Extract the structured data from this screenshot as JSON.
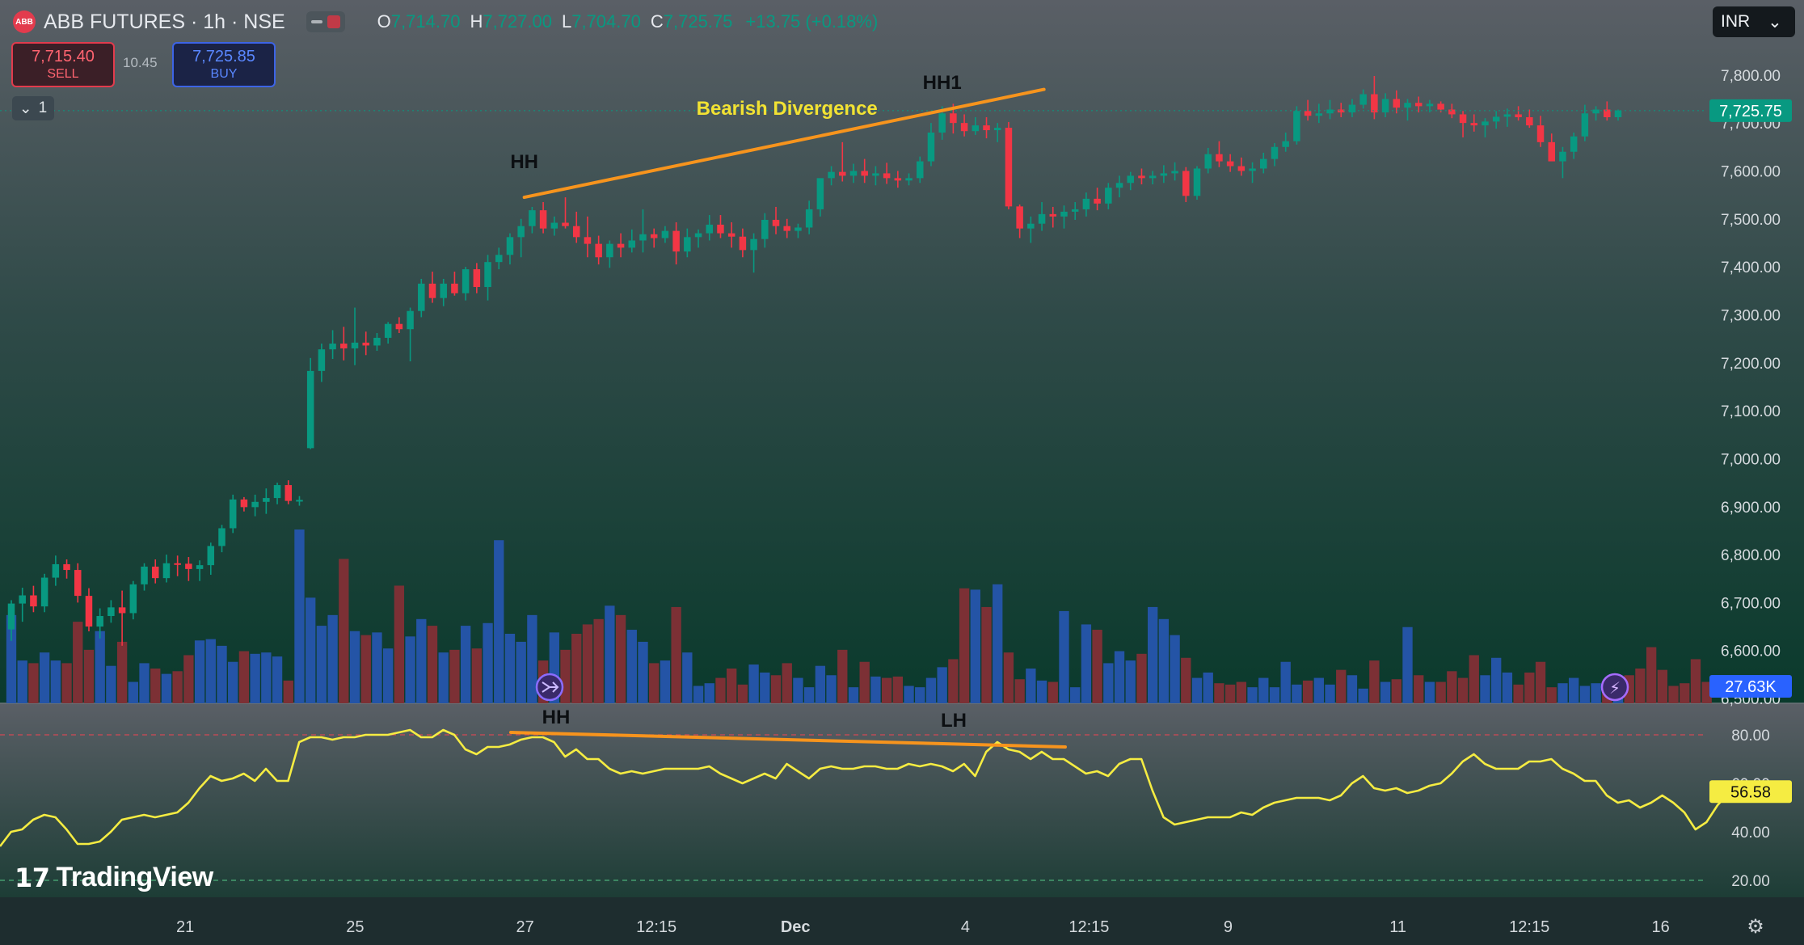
{
  "header": {
    "logo": "ABB",
    "symbol": "ABB FUTURES · 1h · NSE",
    "ohlc": [
      {
        "label": "O",
        "value": "7,714.70"
      },
      {
        "label": "H",
        "value": "7,727.00"
      },
      {
        "label": "L",
        "value": "7,704.70"
      },
      {
        "label": "C",
        "value": "7,725.75"
      }
    ],
    "change": "+13.75 (+0.18%)"
  },
  "trade": {
    "sell_price": "7,715.40",
    "sell_label": "SELL",
    "spread": "10.45",
    "buy_price": "7,725.85",
    "buy_label": "BUY"
  },
  "layers_count": "1",
  "currency": "INR",
  "brand": "TradingView",
  "colors": {
    "up": "#089981",
    "down": "#f23645",
    "annotation": "#f7941d",
    "annotation_text": "#f2e233",
    "rsi": "#f5ec42",
    "vol_up": "#2454a6",
    "vol_down": "#7c3035"
  },
  "chart_data": [
    {
      "type": "candlestick",
      "series_name": "ABB FUTURES",
      "timeframe": "1h",
      "x_tick_labels": [
        "21",
        "25",
        "27",
        "12:15",
        "Dec",
        "4",
        "12:15",
        "9",
        "11",
        "12:15",
        "16"
      ],
      "y_tick_labels": [
        "6,500.00",
        "6,600.00",
        "6,700.00",
        "6,800.00",
        "6,900.00",
        "7,000.00",
        "7,100.00",
        "7,200.00",
        "7,300.00",
        "7,400.00",
        "7,500.00",
        "7,600.00",
        "7,700.00",
        "7,800.00"
      ],
      "ylim": [
        6490,
        7830
      ],
      "last_price": "7,725.75",
      "candles": [
        [
          6644,
          6705,
          6620,
          6698
        ],
        [
          6698,
          6731,
          6660,
          6715
        ],
        [
          6715,
          6735,
          6680,
          6692
        ],
        [
          6692,
          6760,
          6680,
          6752
        ],
        [
          6752,
          6798,
          6735,
          6780
        ],
        [
          6780,
          6790,
          6750,
          6768
        ],
        [
          6768,
          6782,
          6700,
          6714
        ],
        [
          6714,
          6730,
          6640,
          6650
        ],
        [
          6650,
          6688,
          6625,
          6672
        ],
        [
          6672,
          6705,
          6658,
          6690
        ],
        [
          6690,
          6725,
          6610,
          6678
        ],
        [
          6678,
          6745,
          6665,
          6738
        ],
        [
          6738,
          6782,
          6725,
          6775
        ],
        [
          6775,
          6790,
          6740,
          6751
        ],
        [
          6751,
          6800,
          6742,
          6782
        ],
        [
          6782,
          6798,
          6755,
          6781
        ],
        [
          6781,
          6795,
          6745,
          6770
        ],
        [
          6770,
          6788,
          6745,
          6778
        ],
        [
          6778,
          6825,
          6758,
          6818
        ],
        [
          6818,
          6862,
          6805,
          6855
        ],
        [
          6855,
          6925,
          6845,
          6915
        ],
        [
          6915,
          6920,
          6890,
          6899
        ],
        [
          6899,
          6925,
          6880,
          6910
        ],
        [
          6910,
          6938,
          6885,
          6918
        ],
        [
          6918,
          6950,
          6905,
          6945
        ],
        [
          6945,
          6955,
          6905,
          6912
        ],
        [
          6912,
          6922,
          6902,
          6914
        ],
        [
          7022,
          7210,
          7020,
          7183
        ],
        [
          7183,
          7240,
          7160,
          7228
        ],
        [
          7228,
          7268,
          7208,
          7240
        ],
        [
          7240,
          7275,
          7205,
          7230
        ],
        [
          7230,
          7315,
          7195,
          7242
        ],
        [
          7242,
          7265,
          7216,
          7236
        ],
        [
          7236,
          7262,
          7225,
          7252
        ],
        [
          7252,
          7285,
          7240,
          7281
        ],
        [
          7281,
          7295,
          7262,
          7270
        ],
        [
          7270,
          7315,
          7203,
          7308
        ],
        [
          7308,
          7375,
          7295,
          7365
        ],
        [
          7365,
          7390,
          7325,
          7335
        ],
        [
          7335,
          7375,
          7318,
          7365
        ],
        [
          7365,
          7390,
          7340,
          7345
        ],
        [
          7345,
          7400,
          7330,
          7395
        ],
        [
          7395,
          7408,
          7345,
          7358
        ],
        [
          7358,
          7425,
          7330,
          7410
        ],
        [
          7410,
          7440,
          7395,
          7425
        ],
        [
          7425,
          7470,
          7405,
          7462
        ],
        [
          7462,
          7500,
          7420,
          7485
        ],
        [
          7485,
          7525,
          7470,
          7518
        ],
        [
          7518,
          7535,
          7470,
          7480
        ],
        [
          7480,
          7505,
          7465,
          7492
        ],
        [
          7492,
          7545,
          7480,
          7485
        ],
        [
          7485,
          7515,
          7450,
          7462
        ],
        [
          7462,
          7505,
          7420,
          7448
        ],
        [
          7448,
          7465,
          7405,
          7420
        ],
        [
          7420,
          7455,
          7398,
          7448
        ],
        [
          7448,
          7470,
          7420,
          7440
        ],
        [
          7440,
          7478,
          7430,
          7455
        ],
        [
          7455,
          7520,
          7430,
          7468
        ],
        [
          7468,
          7480,
          7440,
          7460
        ],
        [
          7460,
          7485,
          7450,
          7475
        ],
        [
          7475,
          7493,
          7405,
          7432
        ],
        [
          7432,
          7480,
          7420,
          7462
        ],
        [
          7462,
          7478,
          7440,
          7470
        ],
        [
          7470,
          7508,
          7455,
          7488
        ],
        [
          7488,
          7508,
          7460,
          7470
        ],
        [
          7470,
          7493,
          7440,
          7463
        ],
        [
          7463,
          7480,
          7420,
          7435
        ],
        [
          7435,
          7470,
          7388,
          7458
        ],
        [
          7458,
          7512,
          7440,
          7498
        ],
        [
          7498,
          7525,
          7468,
          7485
        ],
        [
          7485,
          7500,
          7460,
          7475
        ],
        [
          7475,
          7490,
          7460,
          7482
        ],
        [
          7482,
          7538,
          7468,
          7520
        ],
        [
          7520,
          7550,
          7505,
          7585
        ],
        [
          7585,
          7610,
          7570,
          7598
        ],
        [
          7598,
          7660,
          7578,
          7590
        ],
        [
          7590,
          7615,
          7575,
          7600
        ],
        [
          7600,
          7625,
          7575,
          7590
        ],
        [
          7590,
          7610,
          7570,
          7595
        ],
        [
          7595,
          7617,
          7573,
          7585
        ],
        [
          7585,
          7600,
          7565,
          7580
        ],
        [
          7580,
          7595,
          7570,
          7585
        ],
        [
          7585,
          7630,
          7575,
          7620
        ],
        [
          7620,
          7700,
          7610,
          7680
        ],
        [
          7680,
          7735,
          7665,
          7720
        ],
        [
          7720,
          7740,
          7678,
          7700
        ],
        [
          7700,
          7718,
          7672,
          7683
        ],
        [
          7683,
          7712,
          7675,
          7695
        ],
        [
          7695,
          7712,
          7668,
          7685
        ],
        [
          7685,
          7700,
          7660,
          7690
        ],
        [
          7690,
          7702,
          7520,
          7526
        ],
        [
          7526,
          7530,
          7460,
          7480
        ],
        [
          7480,
          7505,
          7450,
          7490
        ],
        [
          7490,
          7535,
          7475,
          7510
        ],
        [
          7510,
          7525,
          7482,
          7505
        ],
        [
          7505,
          7528,
          7480,
          7515
        ],
        [
          7515,
          7535,
          7498,
          7520
        ],
        [
          7520,
          7555,
          7505,
          7542
        ],
        [
          7542,
          7565,
          7518,
          7532
        ],
        [
          7532,
          7575,
          7520,
          7565
        ],
        [
          7565,
          7590,
          7545,
          7575
        ],
        [
          7575,
          7598,
          7560,
          7590
        ],
        [
          7590,
          7605,
          7572,
          7585
        ],
        [
          7585,
          7600,
          7572,
          7590
        ],
        [
          7590,
          7612,
          7575,
          7595
        ],
        [
          7595,
          7618,
          7580,
          7600
        ],
        [
          7600,
          7608,
          7535,
          7548
        ],
        [
          7548,
          7610,
          7540,
          7605
        ],
        [
          7605,
          7648,
          7595,
          7635
        ],
        [
          7635,
          7662,
          7608,
          7620
        ],
        [
          7620,
          7635,
          7598,
          7610
        ],
        [
          7610,
          7628,
          7590,
          7600
        ],
        [
          7600,
          7618,
          7575,
          7605
        ],
        [
          7605,
          7638,
          7595,
          7625
        ],
        [
          7625,
          7658,
          7610,
          7650
        ],
        [
          7650,
          7680,
          7640,
          7662
        ],
        [
          7662,
          7735,
          7655,
          7725
        ],
        [
          7725,
          7748,
          7705,
          7715
        ],
        [
          7715,
          7740,
          7700,
          7720
        ],
        [
          7720,
          7748,
          7708,
          7728
        ],
        [
          7728,
          7742,
          7712,
          7722
        ],
        [
          7722,
          7750,
          7712,
          7738
        ],
        [
          7738,
          7770,
          7730,
          7760
        ],
        [
          7760,
          7798,
          7708,
          7722
        ],
        [
          7722,
          7762,
          7712,
          7750
        ],
        [
          7750,
          7768,
          7720,
          7732
        ],
        [
          7732,
          7750,
          7705,
          7742
        ],
        [
          7742,
          7755,
          7722,
          7735
        ],
        [
          7735,
          7748,
          7722,
          7740
        ],
        [
          7740,
          7745,
          7722,
          7728
        ],
        [
          7728,
          7740,
          7710,
          7718
        ],
        [
          7718,
          7725,
          7670,
          7700
        ],
        [
          7700,
          7718,
          7682,
          7695
        ],
        [
          7695,
          7710,
          7670,
          7703
        ],
        [
          7703,
          7725,
          7688,
          7713
        ],
        [
          7713,
          7730,
          7692,
          7718
        ],
        [
          7718,
          7735,
          7705,
          7712
        ],
        [
          7712,
          7728,
          7690,
          7695
        ],
        [
          7695,
          7715,
          7650,
          7660
        ],
        [
          7660,
          7678,
          7628,
          7620
        ],
        [
          7620,
          7650,
          7585,
          7640
        ],
        [
          7640,
          7680,
          7625,
          7672
        ],
        [
          7672,
          7738,
          7662,
          7720
        ],
        [
          7720,
          7735,
          7705,
          7728
        ],
        [
          7728,
          7745,
          7705,
          7712
        ],
        [
          7712,
          7728,
          7705,
          7726
        ]
      ],
      "annotations": [
        {
          "text": "Bearish Divergence"
        },
        {
          "text": "HH"
        },
        {
          "text": "HH1"
        }
      ]
    },
    {
      "type": "bar",
      "series_name": "Volume",
      "last_value": "27.63K",
      "values": [
        6.6,
        3.2,
        3.0,
        3.8,
        3.2,
        3.0,
        6.1,
        4.0,
        5.4,
        2.8,
        4.6,
        1.6,
        3.0,
        2.6,
        2.2,
        2.4,
        3.6,
        4.7,
        4.8,
        4.3,
        3.1,
        3.9,
        3.7,
        3.8,
        3.5,
        1.7,
        13.0,
        7.9,
        5.8,
        6.6,
        10.8,
        5.4,
        5.1,
        5.3,
        4.1,
        8.8,
        5.0,
        6.3,
        5.8,
        3.8,
        4.0,
        5.8,
        4.1,
        6.0,
        12.2,
        5.2,
        4.6,
        6.6,
        3.2,
        5.3,
        4.0,
        5.2,
        5.9,
        6.3,
        7.3,
        6.6,
        5.5,
        4.6,
        3.0,
        3.2,
        7.2,
        3.8,
        1.3,
        1.5,
        1.9,
        2.6,
        1.4,
        2.9,
        2.3,
        2.1,
        3.0,
        1.9,
        1.2,
        2.8,
        2.1,
        4.0,
        1.2,
        3.1,
        2.0,
        1.9,
        2.0,
        1.3,
        1.2,
        1.9,
        2.7,
        3.3,
        8.6,
        8.5,
        7.2,
        8.9,
        3.8,
        1.8,
        2.6,
        1.7,
        1.6,
        6.9,
        1.2,
        5.9,
        5.5,
        3.0,
        3.9,
        3.2,
        3.7,
        7.2,
        6.3,
        5.1,
        3.4,
        1.9,
        2.3,
        1.5,
        1.4,
        1.6,
        1.2,
        1.9,
        1.2,
        3.1,
        1.4,
        1.7,
        1.9,
        1.4,
        2.5,
        2.1,
        1.1,
        3.2,
        1.6,
        1.8,
        5.7,
        2.1,
        1.6,
        1.6,
        2.4,
        1.9,
        3.6,
        2.1,
        3.4,
        2.3,
        1.4,
        2.3,
        3.1,
        1.2,
        1.5,
        1.9,
        1.3,
        1.5,
        1.3,
        1.9,
        2.1,
        2.6,
        4.2,
        2.5,
        1.3,
        1.5,
        3.3,
        1.6
      ]
    },
    {
      "type": "line",
      "series_name": "RSI",
      "y_tick_labels": [
        "20.00",
        "40.00",
        "60.00",
        "80.00"
      ],
      "ylim": [
        13,
        93
      ],
      "reference_lines": [
        80,
        20
      ],
      "last_value": "56.58",
      "values": [
        34,
        40,
        41,
        45,
        47,
        46,
        41,
        35,
        35,
        36,
        40,
        45,
        46,
        47,
        46,
        47,
        48,
        52,
        58,
        63,
        61,
        62,
        64,
        61,
        66,
        61,
        61,
        77,
        79,
        79,
        78,
        79,
        79,
        80,
        80,
        80,
        81,
        82,
        79,
        79,
        82,
        80,
        74,
        72,
        75,
        75,
        76,
        78,
        79,
        79,
        77,
        71,
        74,
        70,
        70,
        66,
        64,
        65,
        64,
        65,
        66,
        66,
        66,
        66,
        67,
        64,
        62,
        60,
        62,
        64,
        62,
        68,
        65,
        62,
        66,
        67,
        66,
        66,
        67,
        67,
        66,
        66,
        68,
        67,
        68,
        67,
        65,
        68,
        63,
        73,
        77,
        74,
        73,
        70,
        73,
        70,
        70,
        67,
        64,
        65,
        63,
        68,
        70,
        70,
        57,
        46,
        43,
        44,
        45,
        46,
        46,
        46,
        48,
        47,
        50,
        52,
        53,
        54,
        54,
        54,
        53,
        55,
        60,
        63,
        58,
        57,
        58,
        56,
        57,
        59,
        60,
        64,
        69,
        72,
        68,
        66,
        66,
        66,
        69,
        69,
        70,
        66,
        64,
        61,
        61,
        55,
        52,
        53,
        50,
        52,
        55,
        52,
        48,
        41,
        44,
        51,
        56,
        56,
        55,
        56
      ]
    }
  ]
}
